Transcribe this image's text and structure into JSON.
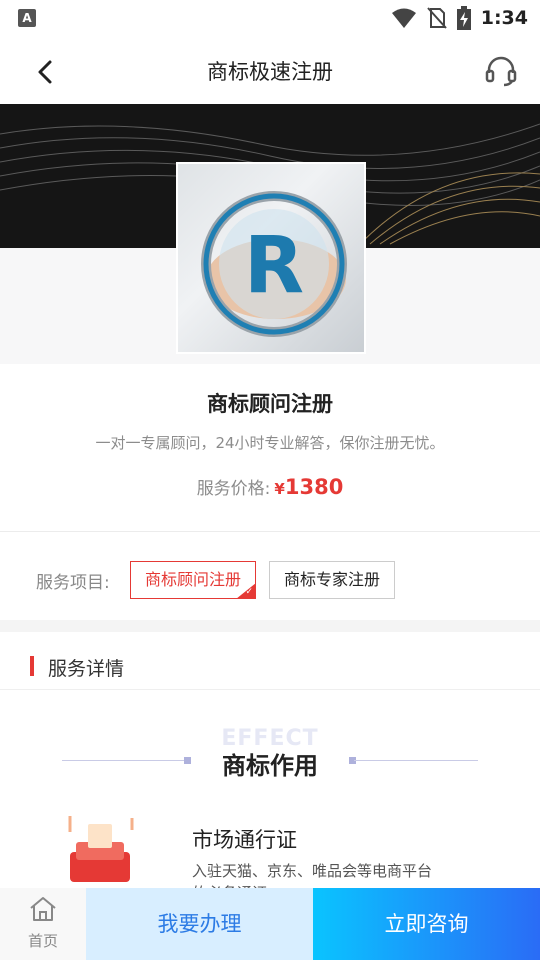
{
  "status_bar": {
    "time": "1:34",
    "notification_glyph": "A"
  },
  "navbar": {
    "title": "商标极速注册",
    "back_icon": "back-arrow-icon",
    "service_icon": "headset-icon"
  },
  "product": {
    "title": "商标顾问注册",
    "description": "一对一专属顾问，24小时专业解答，保你注册无忧。",
    "price_label": "服务价格:",
    "price_currency": "¥",
    "price_value": "1380"
  },
  "options": {
    "label": "服务项目:",
    "items": [
      {
        "label": "商标顾问注册",
        "selected": true
      },
      {
        "label": "商标专家注册",
        "selected": false
      }
    ]
  },
  "section": {
    "title": "服务详情"
  },
  "effect": {
    "en_title": "EFFECT",
    "title": "商标作用",
    "item_title": "市场通行证",
    "item_desc": "入驻天猫、京东、唯品会等电商平台",
    "item_desc2": "的必备通证"
  },
  "bottom_bar": {
    "home_label": "首页",
    "handle_label": "我要办理",
    "consult_label": "立即咨询"
  },
  "colors": {
    "accent_red": "#e53935",
    "consult_gradient_start": "#0ac4ff",
    "consult_gradient_end": "#2a6cf6",
    "handle_bg": "#d8eeff"
  }
}
